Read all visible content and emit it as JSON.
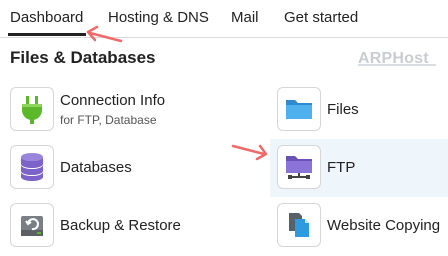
{
  "tabs": [
    {
      "label": "Dashboard"
    },
    {
      "label": "Hosting & DNS"
    },
    {
      "label": "Mail"
    },
    {
      "label": "Get started"
    }
  ],
  "section": {
    "title": "Files & Databases"
  },
  "watermark": {
    "text": "ARPHost"
  },
  "items": {
    "connection": {
      "label": "Connection Info",
      "sublabel": "for FTP, Database",
      "icon": "plug-icon"
    },
    "files": {
      "label": "Files",
      "icon": "folder-icon"
    },
    "databases": {
      "label": "Databases",
      "icon": "database-icon"
    },
    "ftp": {
      "label": "FTP",
      "icon": "ftp-folder-icon"
    },
    "backup": {
      "label": "Backup & Restore",
      "icon": "backup-icon"
    },
    "website_copying": {
      "label": "Website Copying",
      "icon": "copy-icon"
    }
  },
  "colors": {
    "annotation_arrow": "#f06a6a",
    "accent_blue": "#2e9be0",
    "purple": "#7b63c9",
    "green": "#5ab82a",
    "highlight": "#eef5fb"
  }
}
